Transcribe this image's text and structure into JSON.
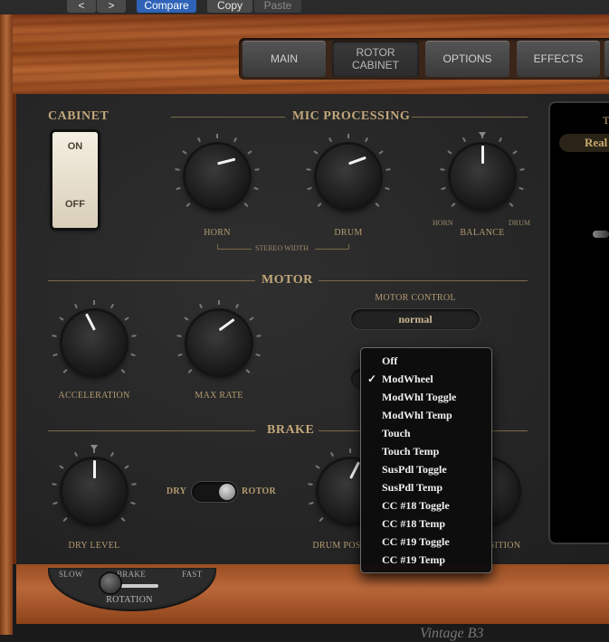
{
  "toolbar": {
    "back": "<",
    "forward": ">",
    "compare": "Compare",
    "copy": "Copy",
    "paste": "Paste"
  },
  "tabs": [
    {
      "label": "MAIN"
    },
    {
      "label": "ROTOR\nCABINET",
      "line1": "ROTOR",
      "line2": "CABINET"
    },
    {
      "label": "OPTIONS"
    },
    {
      "label": "EFFECTS"
    }
  ],
  "cabinet": {
    "title": "CABINET",
    "on": "ON",
    "off": "OFF"
  },
  "mic": {
    "title": "MIC PROCESSING",
    "horn": "HORN",
    "drum": "DRUM",
    "balance": "BALANCE",
    "stereo_width": "STEREO WIDTH",
    "horn_small": "HORN",
    "drum_small": "DRUM"
  },
  "motor": {
    "title": "MOTOR",
    "acceleration": "ACCELERATION",
    "max_rate": "MAX RATE",
    "control_label": "MOTOR CONTROL",
    "control_value": "normal"
  },
  "brake": {
    "title": "BRAKE",
    "dry_level": "DRY LEVEL",
    "dry": "DRY",
    "rotor": "ROTOR",
    "drum_pos": "DRUM POS",
    "position": "SITION"
  },
  "rotation": {
    "slow": "SLOW",
    "brake": "BRAKE",
    "fast": "FAST",
    "label": "ROTATION"
  },
  "right": {
    "t": "T",
    "real": "Real"
  },
  "footer": {
    "text": "Vintage B3"
  },
  "menu": {
    "selected": "ModWheel",
    "items": [
      "Off",
      "ModWheel",
      "ModWhl Toggle",
      "ModWhl Temp",
      "Touch",
      "Touch Temp",
      "SusPdl Toggle",
      "SusPdl Temp",
      "CC #18 Toggle",
      "CC #18 Temp",
      "CC #19 Toggle",
      "CC #19 Temp"
    ]
  },
  "knobs": {
    "horn": 0.78,
    "drum": 0.76,
    "balance": 0.5,
    "acceleration": 0.4,
    "max_rate": 0.7,
    "dry_level": 0.5,
    "drum_pos": 0.6
  }
}
